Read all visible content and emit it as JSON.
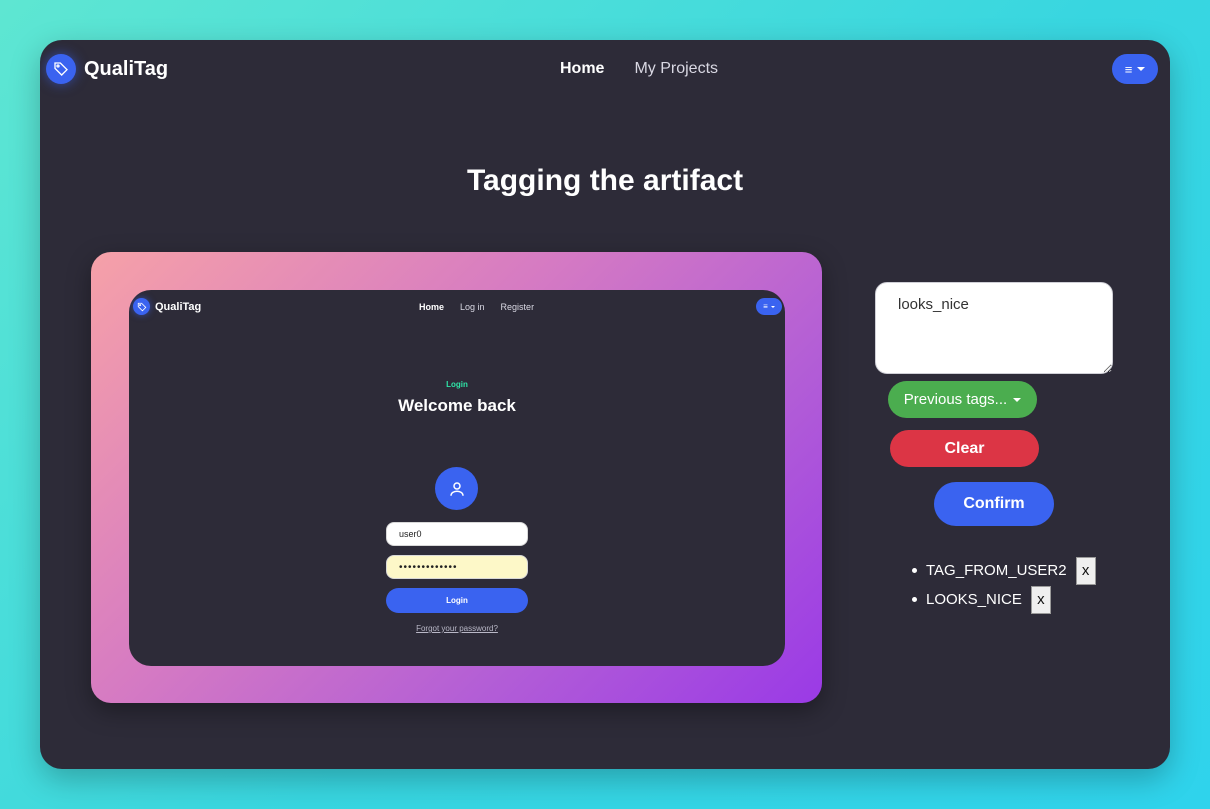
{
  "app": {
    "brand": "QualiTag",
    "nav": {
      "home": "Home",
      "projects": "My Projects"
    },
    "menu_icon": "hamburger-icon"
  },
  "page": {
    "title": "Tagging the artifact"
  },
  "artifact": {
    "brand": "QualiTag",
    "nav": {
      "home": "Home",
      "login": "Log in",
      "register": "Register"
    },
    "eyebrow": "Login",
    "heading": "Welcome back",
    "username_value": "user0",
    "password_value": "•••••••••••••",
    "login_button": "Login",
    "forgot_link": "Forgot your password?"
  },
  "tagging": {
    "input_value": "looks_nice",
    "previous_tags_label": "Previous tags...",
    "clear_label": "Clear",
    "confirm_label": "Confirm",
    "tags": [
      {
        "label": "TAG_FROM_USER2",
        "remove": "x"
      },
      {
        "label": "LOOKS_NICE",
        "remove": "x"
      }
    ]
  },
  "colors": {
    "accent": "#3a63f0",
    "success": "#4bad4f",
    "danger": "#dc3545",
    "window_bg": "#2d2b38"
  }
}
